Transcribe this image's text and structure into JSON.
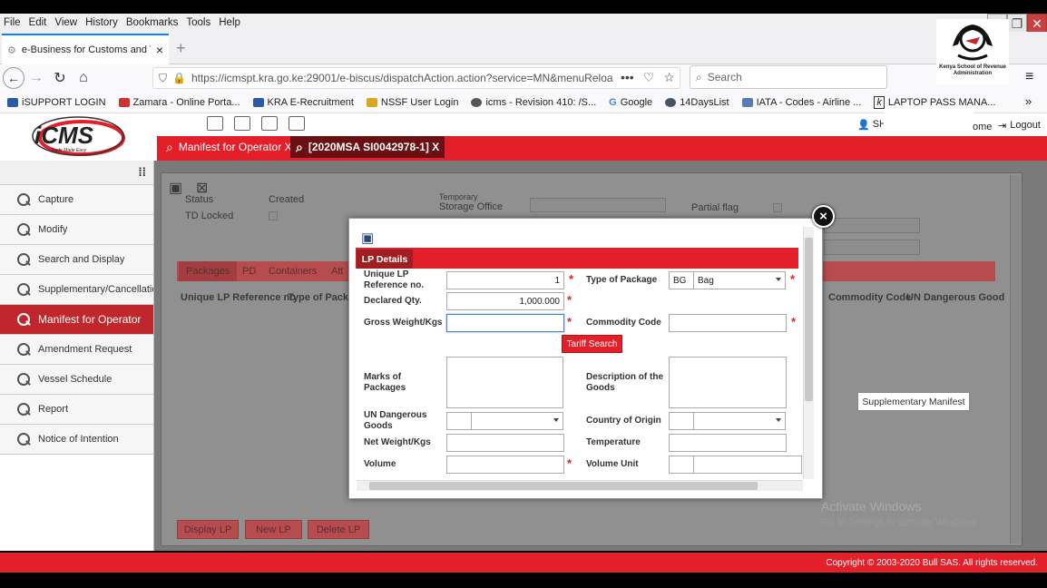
{
  "menu": [
    "File",
    "Edit",
    "View",
    "History",
    "Bookmarks",
    "Tools",
    "Help"
  ],
  "browser_tab": {
    "title": "e-Business for Customs and T",
    "close": "×",
    "new_tab": "+"
  },
  "url": "https://icmspt.kra.go.ke:29001/e-biscus/dispatchAction.action?service=MN&menuReloa",
  "search_placeholder": "Search",
  "bookmarks": [
    "iSUPPORT LOGIN",
    "Zamara - Online Porta...",
    "KRA E-Recruitment",
    "NSSF User Login",
    "icms - Revision 410: /S...",
    "Google",
    "14DaysList",
    "IATA - Codes - Airline ...",
    "LAPTOP PASS MANA..."
  ],
  "ksr_logo_text": "Kenya School of Revenue Administration",
  "app": {
    "logo": "iCMS",
    "logo_tagline": "Trade Made Easy",
    "tabs": [
      "Manifest for Operator X",
      "[2020MSA SI0042978-1] X"
    ],
    "user_prefix": "SH",
    "home": "ome",
    "logout": "Logout"
  },
  "sidebar": {
    "items": [
      {
        "label": "Capture"
      },
      {
        "label": "Modify"
      },
      {
        "label": "Search and Display"
      },
      {
        "label": "Supplementary/Cancellation"
      },
      {
        "label": "Manifest for Operator"
      },
      {
        "label": "Amendment Request"
      },
      {
        "label": "Vessel Schedule"
      },
      {
        "label": "Report"
      },
      {
        "label": "Notice of Intention"
      }
    ]
  },
  "background": {
    "status_label": "Status",
    "status_value": "Created",
    "td_locked": "TD Locked",
    "storage_office": "Storage Office",
    "temporary": "Temporary",
    "partial_flag": "Partial flag",
    "pkg_tabs": [
      "Packages",
      "PD",
      "Containers",
      "Att"
    ],
    "columns": [
      "Unique LP Reference no",
      "Type of Packag",
      "Commodity Code",
      "UN Dangerous Good"
    ],
    "buttons": [
      "Display LP",
      "New LP",
      "Delete LP"
    ],
    "supplementary": "Supplementary Manifest",
    "activate_1": "Activate Windows",
    "activate_2": "Go to Settings to activate Windows."
  },
  "modal": {
    "tab": "LP Details",
    "fields": {
      "unique_lp_label": "Unique LP Reference no.",
      "unique_lp_value": "1",
      "type_pkg_label": "Type of Package",
      "type_pkg_code": "BG",
      "type_pkg_name": "Bag",
      "declared_qty_label": "Declared Qty.",
      "declared_qty_value": "1,000.000",
      "gross_weight_label": "Gross Weight/Kgs",
      "gross_weight_value": "",
      "commodity_label": "Commodity Code",
      "tariff_button": "Tariff Search",
      "marks_label": "Marks of Packages",
      "desc_label": "Description of the Goods",
      "un_dangerous_label": "UN Dangerous Goods",
      "country_label": "Country of Origin",
      "net_weight_label": "Net Weight/Kgs",
      "temperature_label": "Temperature",
      "volume_label": "Volume",
      "volume_unit_label": "Volume Unit"
    },
    "required_mark": "*",
    "close": "×"
  },
  "footer": "Copyright © 2003-2020 Bull SAS. All rights reserved."
}
